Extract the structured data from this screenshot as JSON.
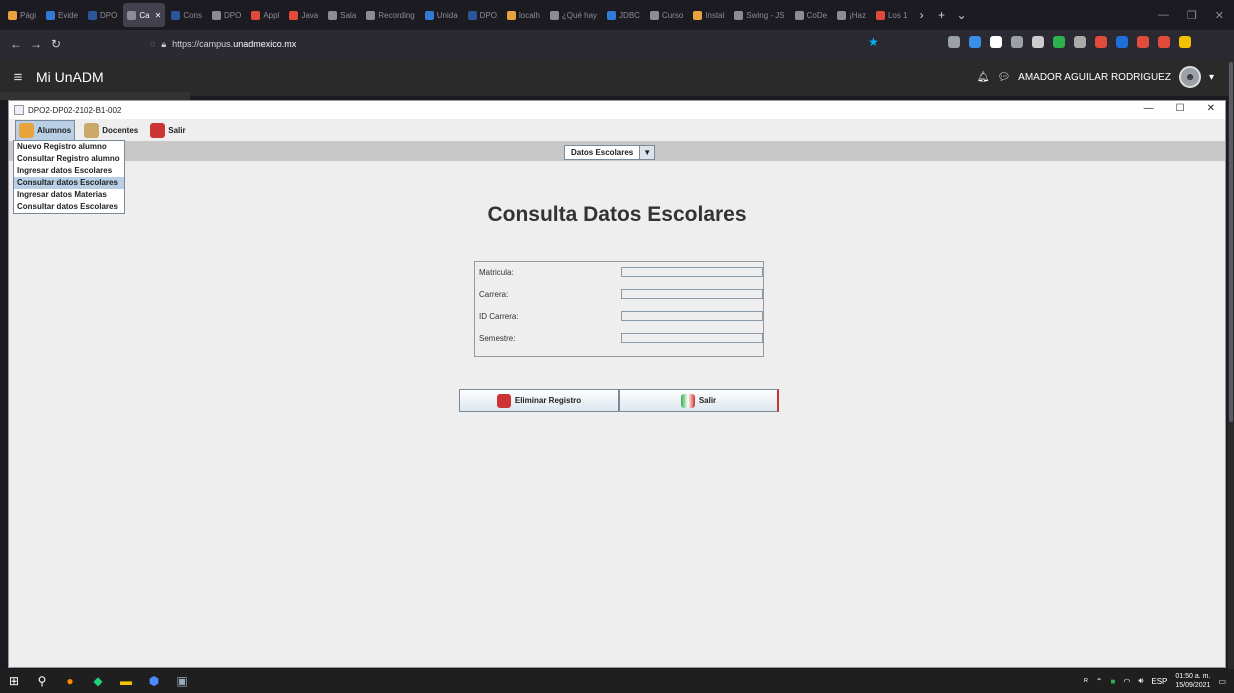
{
  "browser": {
    "tabs": [
      {
        "label": "Pági",
        "color": "#e8a33d",
        "active": false
      },
      {
        "label": "Evide",
        "color": "#2f7bd6",
        "active": false
      },
      {
        "label": "DPO",
        "color": "#2b579a",
        "active": false
      },
      {
        "label": "Ca",
        "color": "#8c8c95",
        "active": true
      },
      {
        "label": "Cons",
        "color": "#2b579a",
        "active": false
      },
      {
        "label": "DPO",
        "color": "#8c8c95",
        "active": false
      },
      {
        "label": "Appl",
        "color": "#e04b3c",
        "active": false
      },
      {
        "label": "Java",
        "color": "#e04b3c",
        "active": false
      },
      {
        "label": "Sala",
        "color": "#8c8c95",
        "active": false
      },
      {
        "label": "Recording",
        "color": "#8c8c95",
        "active": false
      },
      {
        "label": "Unida",
        "color": "#2f7bd6",
        "active": false
      },
      {
        "label": "DPO",
        "color": "#2b579a",
        "active": false
      },
      {
        "label": "localh",
        "color": "#e8a33d",
        "active": false
      },
      {
        "label": "¿Qué hay",
        "color": "#8c8c95",
        "active": false
      },
      {
        "label": "JDBC",
        "color": "#2f7bd6",
        "active": false
      },
      {
        "label": "Curso",
        "color": "#8c8c95",
        "active": false
      },
      {
        "label": "Instal",
        "color": "#e8a33d",
        "active": false
      },
      {
        "label": "Swing - JS",
        "color": "#8c8c95",
        "active": false
      },
      {
        "label": "CoDe",
        "color": "#8c8c95",
        "active": false
      },
      {
        "label": "¡Haz",
        "color": "#8c8c95",
        "active": false
      },
      {
        "label": "Los 1",
        "color": "#e04b3c",
        "active": false
      }
    ],
    "url_prefix": "https://campus.",
    "url_domain": "unadmexico.mx",
    "extension_colors": [
      "#9aa0a6",
      "#3a8ee6",
      "#ffffff",
      "#9aa0a6",
      "#cccccc",
      "#2bb24c",
      "#aaaaaa",
      "#e04b3c",
      "#1e6fd9",
      "#e04b3c",
      "#e04b3c",
      "#f2c200"
    ]
  },
  "site": {
    "brand": "Mi UnADM",
    "user_name": "AMADOR AGUILAR RODRIGUEZ"
  },
  "window": {
    "title": "DPO2-DP02-2102-B1-002",
    "menus": [
      {
        "label": "Alumnos",
        "icon": "students-icon",
        "color": "#e8a33d",
        "open": true
      },
      {
        "label": "Docentes",
        "icon": "teachers-icon",
        "color": "#c9a86a",
        "open": false
      },
      {
        "label": "Salir",
        "icon": "exit-icon",
        "color": "#cc3333",
        "open": false
      }
    ],
    "dropdown_items": [
      {
        "label": "Nuevo Registro alumno",
        "selected": false
      },
      {
        "label": "Consultar Registro alumno",
        "selected": false
      },
      {
        "label": "Ingresar datos Escolares",
        "selected": false
      },
      {
        "label": "Consultar datos Escolares",
        "selected": true
      },
      {
        "label": "Ingresar datos Materias",
        "selected": false
      },
      {
        "label": "Consultar datos Escolares",
        "selected": false
      }
    ],
    "combo_value": "Datos Escolares",
    "heading": "Consulta Datos Escolares",
    "fields": [
      {
        "label": "Matricula:",
        "value": ""
      },
      {
        "label": "Carrera:",
        "value": ""
      },
      {
        "label": "ID Carrera:",
        "value": ""
      },
      {
        "label": "Semestre:",
        "value": ""
      }
    ],
    "buttons": {
      "delete": "Eliminar Registro",
      "exit": "Salir"
    }
  },
  "taskbar": {
    "language": "ESP",
    "time": "01:50 a. m.",
    "date": "15/09/2021"
  }
}
